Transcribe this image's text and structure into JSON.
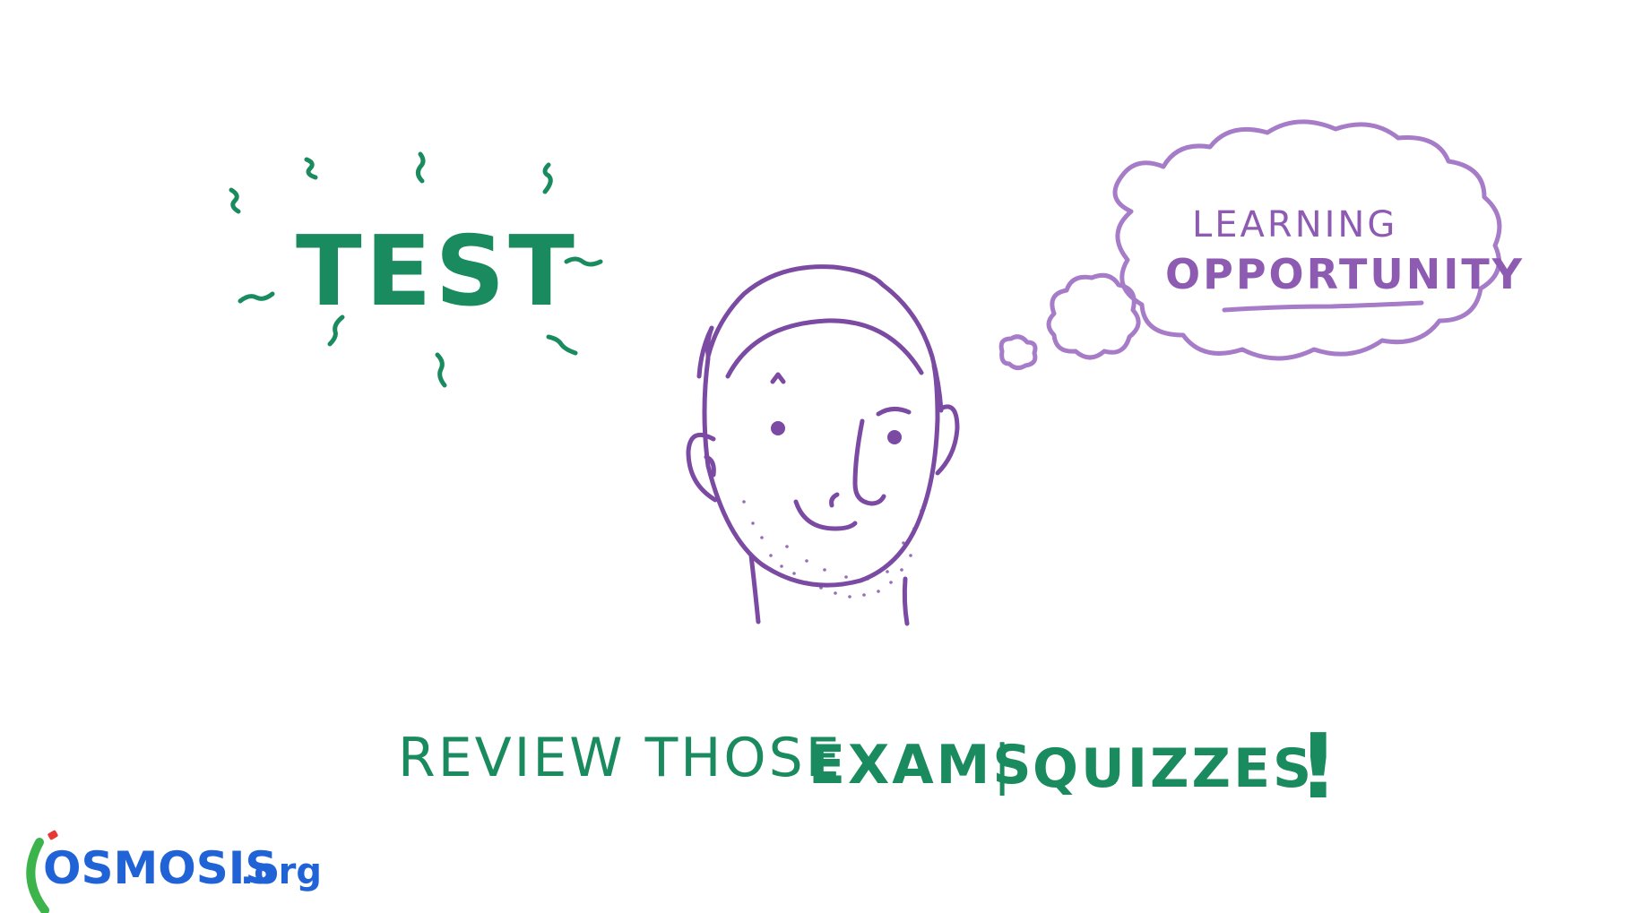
{
  "headline": {
    "word": "TEST"
  },
  "thought_bubble": {
    "line1": "LEARNING",
    "line2": "OPPORTUNITY"
  },
  "caption": {
    "part1": "REVIEW THOSE",
    "part2": "EXAMS",
    "separator": "|",
    "part3": "QUIZZES",
    "exclamation": "!"
  },
  "logo": {
    "osmosis": "OSMOSIS",
    "org": ".org"
  },
  "colors": {
    "green": "#1a8a5f",
    "purple": "#7b4aa3",
    "light_purple": "#a67cc8",
    "logo_blue": "#1f63d6",
    "logo_green": "#3cb44b",
    "logo_red": "#e53935"
  },
  "icons": {
    "character": "smiling-man-face",
    "thought": "thought-cloud",
    "emphasis": "squiggle-rays"
  }
}
